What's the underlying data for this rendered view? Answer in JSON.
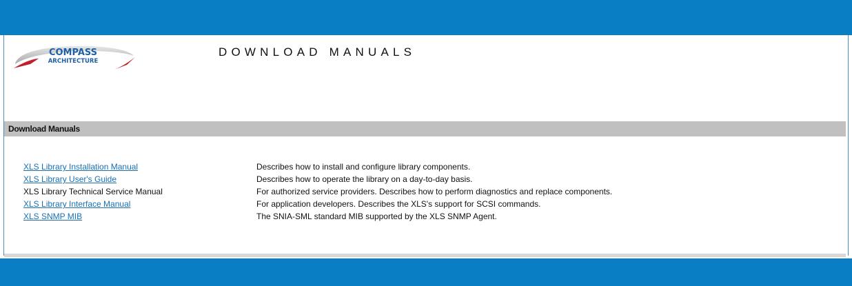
{
  "logo": {
    "line1": "COMPASS",
    "line2": "ARCHITECTURE"
  },
  "header": {
    "title": "DOWNLOAD MANUALS"
  },
  "section": {
    "title": "Download Manuals"
  },
  "manuals": [
    {
      "name": "XLS Library Installation Manual",
      "link": true,
      "description": "Describes how to install and configure library components."
    },
    {
      "name": "XLS Library User's Guide",
      "link": true,
      "description": "Describes how to operate the library on a day-to-day basis."
    },
    {
      "name": "XLS Library Technical Service Manual",
      "link": false,
      "description": "For authorized service providers. Describes how to perform diagnostics and replace components."
    },
    {
      "name": "XLS Library Interface Manual",
      "link": true,
      "description": "For application developers. Describes the XLS's support for SCSI commands."
    },
    {
      "name": "XLS SNMP MIB",
      "link": true,
      "description": "The SNIA-SML standard MIB supported by the XLS SNMP Agent."
    }
  ],
  "colors": {
    "banner_blue": "#0a7ec5",
    "link_blue": "#1a6fb3",
    "section_gray": "#c0c0c0",
    "logo_text_blue": "#1e5fa6",
    "logo_swoosh_red": "#c0202a"
  }
}
